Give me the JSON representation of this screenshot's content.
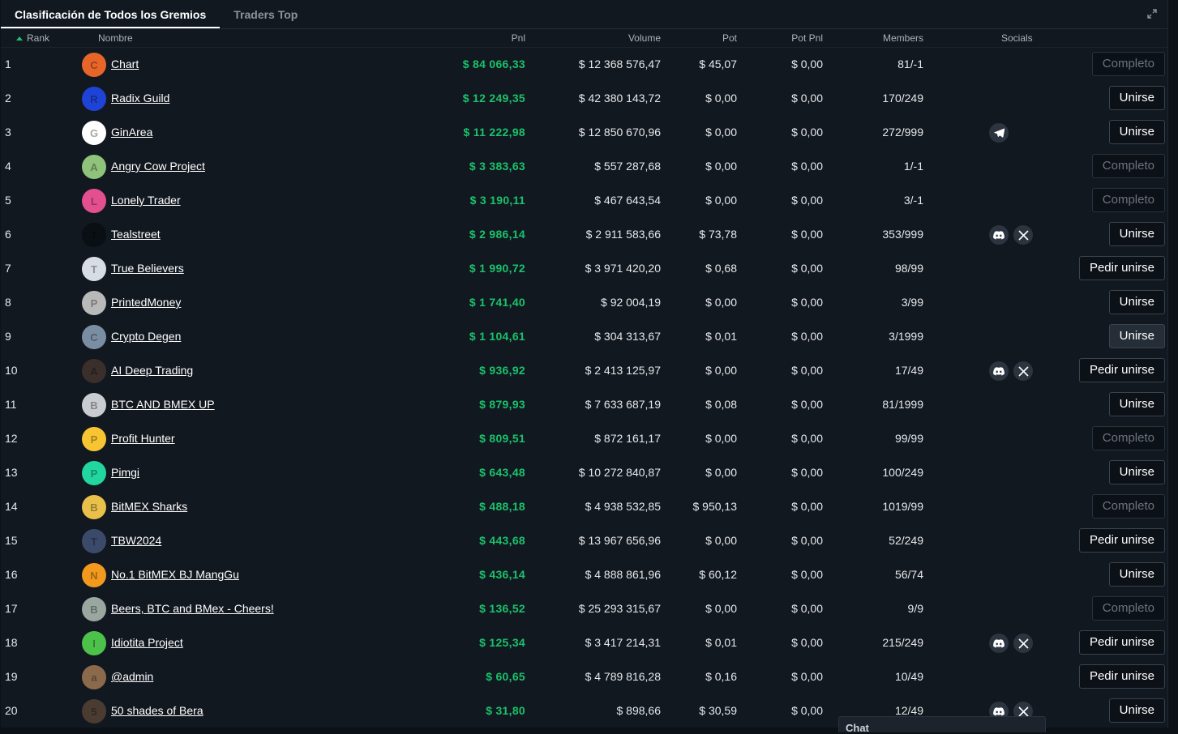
{
  "tabs": [
    {
      "label": "Clasificación de Todos los Gremios",
      "active": true
    },
    {
      "label": "Traders Top",
      "active": false
    }
  ],
  "columns": {
    "rank": "Rank",
    "name": "Nombre",
    "pnl": "Pnl",
    "volume": "Volume",
    "pot": "Pot",
    "pot_pnl": "Pot Pnl",
    "members": "Members",
    "socials": "Socials"
  },
  "colors": {
    "positive": "#19c26b",
    "background": "#121820"
  },
  "rows": [
    {
      "rank": "1",
      "name": "Chart",
      "pnl": "$ 84 066,33",
      "volume": "$ 12 368 576,47",
      "pot": "$ 45,07",
      "pot_pnl": "$ 0,00",
      "members": "81/-1",
      "socials": [],
      "action": "Completo",
      "action_state": "disabled",
      "avatar": "orange-mascot-icon",
      "avatar_color": "#e8652a"
    },
    {
      "rank": "2",
      "name": "Radix Guild",
      "pnl": "$ 12 249,35",
      "volume": "$ 42 380 143,72",
      "pot": "$ 0,00",
      "pot_pnl": "$ 0,00",
      "members": "170/249",
      "socials": [],
      "action": "Unirse",
      "action_state": "normal",
      "avatar": "radix-logo-icon",
      "avatar_color": "#1e43d6"
    },
    {
      "rank": "3",
      "name": "GinArea",
      "pnl": "$ 11 222,98",
      "volume": "$ 12 850 670,96",
      "pot": "$ 0,00",
      "pot_pnl": "$ 0,00",
      "members": "272/999",
      "socials": [
        "telegram-icon"
      ],
      "action": "Unirse",
      "action_state": "normal",
      "avatar": "ginarea-logo-icon",
      "avatar_color": "#ffffff"
    },
    {
      "rank": "4",
      "name": "Angry Cow Project",
      "pnl": "$ 3 383,63",
      "volume": "$ 557 287,68",
      "pot": "$ 0,00",
      "pot_pnl": "$ 0,00",
      "members": "1/-1",
      "socials": [],
      "action": "Completo",
      "action_state": "disabled",
      "avatar": "cow-face-icon",
      "avatar_color": "#8fc27a"
    },
    {
      "rank": "5",
      "name": "Lonely Trader",
      "pnl": "$ 3 190,11",
      "volume": "$ 467 643,54",
      "pot": "$ 0,00",
      "pot_pnl": "$ 0,00",
      "members": "3/-1",
      "socials": [],
      "action": "Completo",
      "action_state": "disabled",
      "avatar": "mushroom-icon",
      "avatar_color": "#e34f8f"
    },
    {
      "rank": "6",
      "name": "Tealstreet",
      "pnl": "$ 2 986,14",
      "volume": "$ 2 911 583,66",
      "pot": "$ 73,78",
      "pot_pnl": "$ 0,00",
      "members": "353/999",
      "socials": [
        "discord-icon",
        "x-icon"
      ],
      "action": "Unirse",
      "action_state": "normal",
      "avatar": "tealstreet-logo-icon",
      "avatar_color": "#0a0f14"
    },
    {
      "rank": "7",
      "name": "True Believers",
      "pnl": "$ 1 990,72",
      "volume": "$ 3 971 420,20",
      "pot": "$ 0,68",
      "pot_pnl": "$ 0,00",
      "members": "98/99",
      "socials": [],
      "action": "Pedir unirse",
      "action_state": "normal",
      "avatar": "rocket-icon",
      "avatar_color": "#d8dde3"
    },
    {
      "rank": "8",
      "name": "PrintedMoney",
      "pnl": "$ 1 741,40",
      "volume": "$ 92 004,19",
      "pot": "$ 0,00",
      "pot_pnl": "$ 0,00",
      "members": "3/99",
      "socials": [],
      "action": "Unirse",
      "action_state": "normal",
      "avatar": "old-man-icon",
      "avatar_color": "#b9b9b9"
    },
    {
      "rank": "9",
      "name": "Crypto Degen",
      "pnl": "$ 1 104,61",
      "volume": "$ 304 313,67",
      "pot": "$ 0,01",
      "pot_pnl": "$ 0,00",
      "members": "3/1999",
      "socials": [],
      "action": "Unirse",
      "action_state": "hover",
      "avatar": "character-icon",
      "avatar_color": "#7a8ea3"
    },
    {
      "rank": "10",
      "name": "AI Deep Trading",
      "pnl": "$ 936,92",
      "volume": "$ 2 413 125,97",
      "pot": "$ 0,00",
      "pot_pnl": "$ 0,00",
      "members": "17/49",
      "socials": [
        "discord-icon",
        "x-icon"
      ],
      "action": "Pedir unirse",
      "action_state": "normal",
      "avatar": "portrait-icon",
      "avatar_color": "#3a2f2a"
    },
    {
      "rank": "11",
      "name": "BTC AND BMEX UP",
      "pnl": "$ 879,93",
      "volume": "$ 7 633 687,19",
      "pot": "$ 0,08",
      "pot_pnl": "$ 0,00",
      "members": "81/1999",
      "socials": [],
      "action": "Unirse",
      "action_state": "normal",
      "avatar": "bmex-logo-icon",
      "avatar_color": "#c9ccd0"
    },
    {
      "rank": "12",
      "name": "Profit Hunter",
      "pnl": "$ 809,51",
      "volume": "$ 872 161,17",
      "pot": "$ 0,00",
      "pot_pnl": "$ 0,00",
      "members": "99/99",
      "socials": [],
      "action": "Completo",
      "action_state": "disabled",
      "avatar": "emoji-tongue-icon",
      "avatar_color": "#f7c531"
    },
    {
      "rank": "13",
      "name": "Pimgi",
      "pnl": "$ 643,48",
      "volume": "$ 10 272 840,87",
      "pot": "$ 0,00",
      "pot_pnl": "$ 0,00",
      "members": "100/249",
      "socials": [],
      "action": "Unirse",
      "action_state": "normal",
      "avatar": "bitcoin-coin-icon",
      "avatar_color": "#22d6a0"
    },
    {
      "rank": "14",
      "name": "BitMEX Sharks",
      "pnl": "$ 488,18",
      "volume": "$ 4 938 532,85",
      "pot": "$ 950,13",
      "pot_pnl": "$ 0,00",
      "members": "1019/99",
      "socials": [],
      "action": "Completo",
      "action_state": "disabled",
      "avatar": "bmex-gold-logo-icon",
      "avatar_color": "#e9c04a"
    },
    {
      "rank": "15",
      "name": "TBW2024",
      "pnl": "$ 443,68",
      "volume": "$ 13 967 656,96",
      "pot": "$ 0,00",
      "pot_pnl": "$ 0,00",
      "members": "52/249",
      "socials": [],
      "action": "Pedir unirse",
      "action_state": "normal",
      "avatar": "anime-character-icon",
      "avatar_color": "#3b4a6b"
    },
    {
      "rank": "16",
      "name": "No.1 BitMEX BJ MangGu",
      "pnl": "$ 436,14",
      "volume": "$ 4 888 861,96",
      "pot": "$ 60,12",
      "pot_pnl": "$ 0,00",
      "members": "56/74",
      "socials": [],
      "action": "Unirse",
      "action_state": "normal",
      "avatar": "bitcoin-orange-icon",
      "avatar_color": "#f39a1e"
    },
    {
      "rank": "17",
      "name": "Beers, BTC and BMex - Cheers!",
      "pnl": "$ 136,52",
      "volume": "$ 25 293 315,67",
      "pot": "$ 0,00",
      "pot_pnl": "$ 0,00",
      "members": "9/9",
      "socials": [],
      "action": "Completo",
      "action_state": "disabled",
      "avatar": "pepe-icon",
      "avatar_color": "#9aa7a0"
    },
    {
      "rank": "18",
      "name": "Idiotita Project",
      "pnl": "$ 125,34",
      "volume": "$ 3 417 214,31",
      "pot": "$ 0,01",
      "pot_pnl": "$ 0,00",
      "members": "215/249",
      "socials": [
        "discord-icon",
        "x-icon"
      ],
      "action": "Pedir unirse",
      "action_state": "normal",
      "avatar": "green-face-icon",
      "avatar_color": "#4cc24a"
    },
    {
      "rank": "19",
      "name": "@admin",
      "pnl": "$ 60,65",
      "volume": "$ 4 789 816,28",
      "pot": "$ 0,16",
      "pot_pnl": "$ 0,00",
      "members": "10/49",
      "socials": [],
      "action": "Pedir unirse",
      "action_state": "normal",
      "avatar": "poop-icon",
      "avatar_color": "#8a6a4a"
    },
    {
      "rank": "20",
      "name": "50 shades of Bera",
      "pnl": "$ 31,80",
      "volume": "$ 898,66",
      "pot": "$ 30,59",
      "pot_pnl": "$ 0,00",
      "members": "12/49",
      "socials": [
        "discord-icon",
        "x-icon"
      ],
      "action": "Unirse",
      "action_state": "normal",
      "avatar": "bear-icon",
      "avatar_color": "#4a3c30"
    }
  ],
  "chat": {
    "label": "Chat"
  }
}
